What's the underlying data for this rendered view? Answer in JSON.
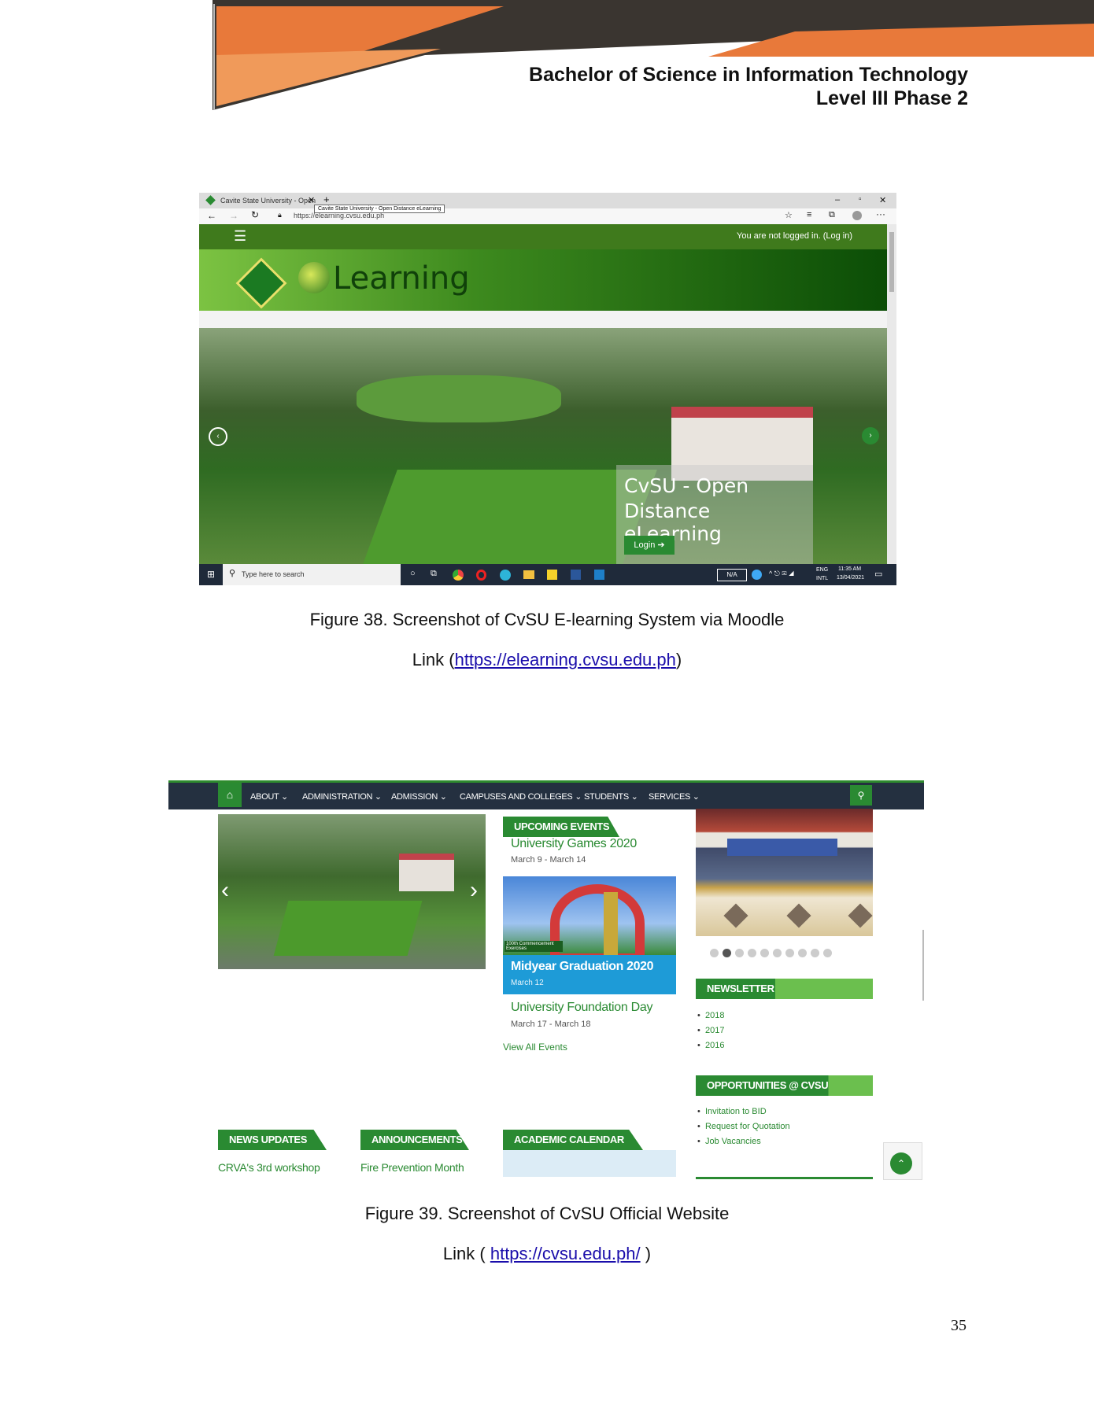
{
  "header": {
    "line1": "Bachelor of Science in Information Technology",
    "line2": "Level III Phase 2"
  },
  "figure1": {
    "browser": {
      "tab_title": "Cavite State University - Open",
      "tab_tooltip": "Cavite State University - Open Distance eLearning",
      "url": "https://elearning.cvsu.edu.ph"
    },
    "site": {
      "login_status": "You are not logged in. (Log in)",
      "logo_text": "Learning",
      "hero_title_1": "CvSU - Open",
      "hero_title_2": "Distance eLearning",
      "login_button": "Login"
    },
    "taskbar": {
      "search_placeholder": "Type here to search",
      "na_label": "N/A",
      "lang1": "ENG",
      "lang2": "INTL",
      "time": "11:35 AM",
      "date": "13/04/2021"
    },
    "caption": "Figure 38. Screenshot of CvSU E-learning System via Moodle",
    "link_prefix": "Link (",
    "link_url": "https://elearning.cvsu.edu.ph",
    "link_suffix": ")"
  },
  "figure2": {
    "nav": [
      "ABOUT",
      "ADMINISTRATION",
      "ADMISSION",
      "CAMPUSES AND COLLEGES",
      "STUDENTS",
      "SERVICES"
    ],
    "events_header": "UPCOMING EVENTS",
    "event1_title": "University Games 2020",
    "event1_date": "March 9 - March 14",
    "event_banner_tag": "100th Commencement Exercises",
    "event2_title": "Midyear Graduation 2020",
    "event2_date": "March 12",
    "event3_title": "University Foundation Day",
    "event3_date": "March 17 - March 18",
    "view_all": "View All Events",
    "newsletter_header": "NEWSLETTER",
    "newsletter_items": [
      "2018",
      "2017",
      "2016"
    ],
    "opportunities_header": "OPPORTUNITIES @ CVSU",
    "opportunities_items": [
      "Invitation to BID",
      "Request for Quotation",
      "Job Vacancies"
    ],
    "news_header": "NEWS UPDATES",
    "news_item": "CRVA's 3rd workshop",
    "announce_header": "ANNOUNCEMENTS",
    "announce_item": "Fire Prevention Month",
    "calendar_header": "ACADEMIC CALENDAR",
    "caption": "Figure 39. Screenshot of CvSU Official Website",
    "link_prefix": "Link ( ",
    "link_url": "https://cvsu.edu.ph/",
    "link_suffix": " )"
  },
  "page_number": "35",
  "colors": {
    "orange": "#e8793a",
    "dark": "#3a3530",
    "green": "#2a8a32",
    "navy": "#243040",
    "blue_card": "#1e9bd7"
  }
}
